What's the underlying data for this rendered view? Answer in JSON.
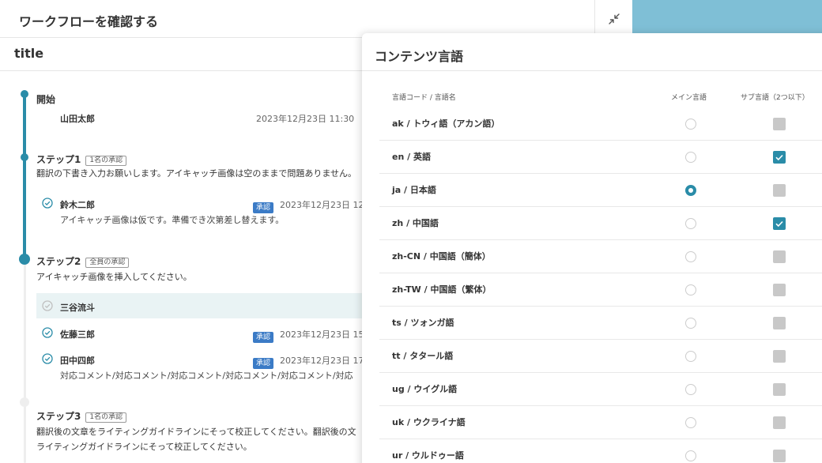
{
  "workflow": {
    "title": "ワークフローを確認する",
    "subtitle": "title",
    "start": {
      "label": "開始",
      "person": "山田太郎",
      "date": "2023年12月23日 11:30"
    },
    "steps": [
      {
        "title": "ステップ1",
        "chip": "1名の承認",
        "desc": "翻訳の下書き入力お願いします。アイキャッチ画像は空のままで問題ありません。",
        "approvers": [
          {
            "name": "鈴木二郎",
            "badge": "承認",
            "date": "2023年12月23日 12",
            "comment": "アイキャッチ画像は仮です。準備でき次第差し替えます。"
          }
        ]
      },
      {
        "title": "ステップ2",
        "chip": "全員の承認",
        "desc": "アイキャッチ画像を挿入してください。",
        "approvers": [
          {
            "name": "三谷流斗"
          },
          {
            "name": "佐藤三郎",
            "badge": "承認",
            "date": "2023年12月23日 15"
          },
          {
            "name": "田中四郎",
            "badge": "承認",
            "date": "2023年12月23日 17",
            "comment": "対応コメント/対応コメント/対応コメント/対応コメント/対応コメント/対応"
          }
        ]
      },
      {
        "title": "ステップ3",
        "chip": "1名の承認",
        "desc": "翻訳後の文章をライティングガイドラインにそって校正してください。翻訳後の文",
        "desc2": "ライティングガイドラインにそって校正してください。"
      }
    ]
  },
  "language_modal": {
    "title": "コンテンツ言語",
    "columns": {
      "code": "言語コード / 言語名",
      "main": "メイン言語",
      "sub": "サブ言語（2つ以下）"
    },
    "languages": [
      {
        "label": "ak / トウィ語（アカン語）",
        "main": false,
        "sub": false
      },
      {
        "label": "en / 英語",
        "main": false,
        "sub": true
      },
      {
        "label": "ja / 日本語",
        "main": true,
        "sub": false
      },
      {
        "label": "zh / 中国語",
        "main": false,
        "sub": true
      },
      {
        "label": "zh-CN / 中国語（簡体）",
        "main": false,
        "sub": false
      },
      {
        "label": "zh-TW / 中国語（繁体）",
        "main": false,
        "sub": false
      },
      {
        "label": "ts / ツォンガ語",
        "main": false,
        "sub": false
      },
      {
        "label": "tt / タタール語",
        "main": false,
        "sub": false
      },
      {
        "label": "ug / ウイグル語",
        "main": false,
        "sub": false
      },
      {
        "label": "uk / ウクライナ語",
        "main": false,
        "sub": false
      },
      {
        "label": "ur / ウルドゥー語",
        "main": false,
        "sub": false
      }
    ]
  },
  "colors": {
    "accent": "#2a8ca8",
    "badge": "#3b7bc6",
    "backdrop": "#7fbfd6"
  },
  "icons": {
    "collapse": "collapse-arrows-icon",
    "check": "check-circle-icon"
  }
}
